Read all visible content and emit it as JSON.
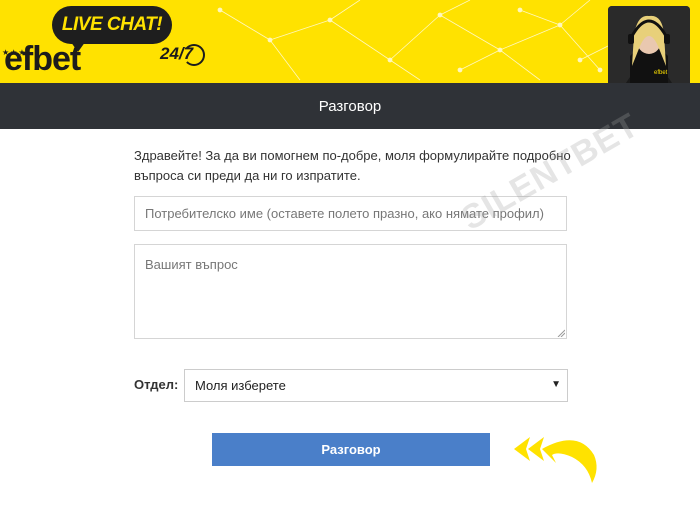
{
  "banner": {
    "live_chat": "LIVE CHAT!",
    "logo": "efbet",
    "badge": "24/7"
  },
  "header": {
    "title": "Разговор"
  },
  "intro": {
    "text": "Здравейте! За да ви помогнем по-добре, моля формулирайте подробно въпроса си преди да ни го изпратите."
  },
  "form": {
    "username_placeholder": "Потребителско име (оставете полето празно, ако нямате профил)",
    "question_placeholder": "Вашият въпрос",
    "department_label": "Отдел:",
    "department_value": "Моля изберете",
    "submit_label": "Разговор"
  },
  "watermark": {
    "text": "SILENTBET"
  },
  "colors": {
    "banner": "#ffe200",
    "titlebar": "#2f3237",
    "button": "#4a7fc9",
    "arrow": "#ffe200"
  },
  "icons": [
    "chevron-down-icon",
    "resize-grip-icon",
    "pointer-arrow-icon",
    "agent-headset-icon"
  ]
}
